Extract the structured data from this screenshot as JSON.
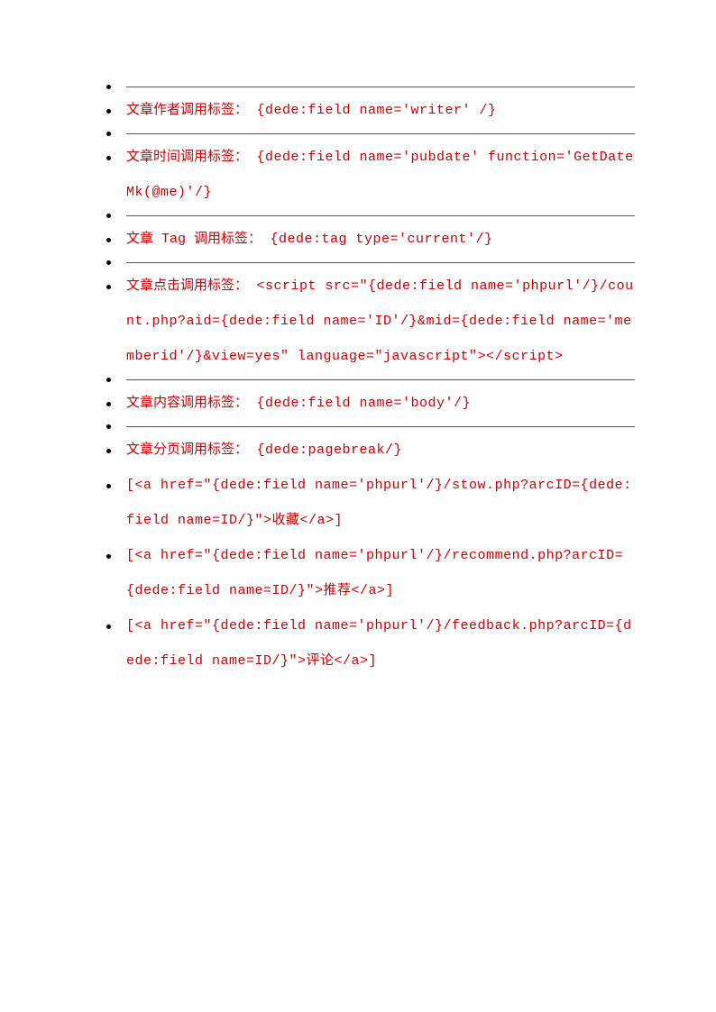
{
  "items": [
    {
      "type": "hr"
    },
    {
      "type": "entry",
      "label": "文章作者调用标签：",
      "code": " {dede:field name='writer' /}"
    },
    {
      "type": "hr"
    },
    {
      "type": "entry",
      "label": "文章时间调用标签：",
      "code": " {dede:field name='pubdate' function='GetDateMk(@me)'/}"
    },
    {
      "type": "hr"
    },
    {
      "type": "entry",
      "label": "文章 Tag 调用标签：",
      "code": " {dede:tag type='current'/}"
    },
    {
      "type": "hr"
    },
    {
      "type": "entry",
      "label": "文章点击调用标签：",
      "code": " <script src=\"{dede:field name='phpurl'/}/count.php?aid={dede:field name='ID'/}&mid={dede:field name='memberid'/}&view=yes\" language=\"javascript\"></script>"
    },
    {
      "type": "hr"
    },
    {
      "type": "entry",
      "label": "文章内容调用标签：",
      "code": " {dede:field name='body'/}"
    },
    {
      "type": "hr"
    },
    {
      "type": "entry",
      "label": "文章分页调用标签：",
      "code": " {dede:pagebreak/}"
    },
    {
      "type": "codeonly",
      "code": "[<a href=\"{dede:field name='phpurl'/}/stow.php?arcID={dede:field name=ID/}\">收藏</a>]"
    },
    {
      "type": "codeonly",
      "code": "[<a href=\"{dede:field name='phpurl'/}/recommend.php?arcID={dede:field name=ID/}\">推荐</a>]"
    },
    {
      "type": "codeonly",
      "code": "[<a href=\"{dede:field name='phpurl'/}/feedback.php?arcID={dede:field name=ID/}\">评论</a>]"
    }
  ]
}
